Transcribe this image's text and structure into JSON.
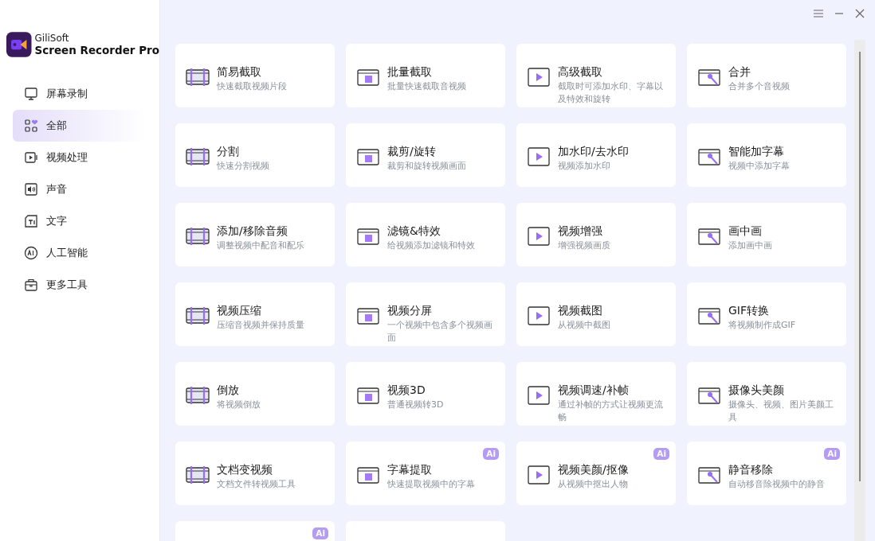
{
  "app": {
    "brand": "GiliSoft",
    "product": "Screen Recorder Pro"
  },
  "sidebar": {
    "items": [
      {
        "label": "屏幕录制",
        "selected": false
      },
      {
        "label": "全部",
        "selected": true
      },
      {
        "label": "视频处理",
        "selected": false
      },
      {
        "label": "声音",
        "selected": false
      },
      {
        "label": "文字",
        "selected": false
      },
      {
        "label": "人工智能",
        "selected": false
      },
      {
        "label": "更多工具",
        "selected": false
      }
    ]
  },
  "cards": [
    {
      "title": "简易截取",
      "description": "快速截取视频片段"
    },
    {
      "title": "批量截取",
      "description": "批量快速截取音视频"
    },
    {
      "title": "高级截取",
      "description": "截取时可添加水印、字幕以及特效和旋转"
    },
    {
      "title": "合并",
      "description": "合并多个音视频"
    },
    {
      "title": "分割",
      "description": "快速分割视频"
    },
    {
      "title": "裁剪/旋转",
      "description": "裁剪和旋转视频画面"
    },
    {
      "title": "加水印/去水印",
      "description": "视频添加水印"
    },
    {
      "title": "智能加字幕",
      "description": "视频中添加字幕"
    },
    {
      "title": "添加/移除音频",
      "description": "调整视频中配音和配乐"
    },
    {
      "title": "滤镜&特效",
      "description": "给视频添加滤镜和特效"
    },
    {
      "title": "视频增强",
      "description": "增强视频画质"
    },
    {
      "title": "画中画",
      "description": "添加画中画"
    },
    {
      "title": "视频压缩",
      "description": "压缩音视频并保持质量"
    },
    {
      "title": "视频分屏",
      "description": "一个视频中包含多个视频画面"
    },
    {
      "title": "视频截图",
      "description": "从视频中截图"
    },
    {
      "title": "GIF转换",
      "description": "将视频制作成GIF"
    },
    {
      "title": "倒放",
      "description": "将视频倒放"
    },
    {
      "title": "视频3D",
      "description": "普通视频转3D"
    },
    {
      "title": "视频调速/补帧",
      "description": "通过补帧的方式让视频更流畅"
    },
    {
      "title": "摄像头美颜",
      "description": "摄像头、视频、图片美颜工具"
    },
    {
      "title": "文档变视频",
      "description": "文档文件转视频工具"
    },
    {
      "title": "字幕提取",
      "description": "快速提取视频中的字幕",
      "badge": "Ai"
    },
    {
      "title": "视频美颜/抠像",
      "description": "从视频中抠出人物",
      "badge": "Ai"
    },
    {
      "title": "静音移除",
      "description": "自动移音除视频中的静音",
      "badge": "Ai"
    },
    {
      "kind": "partial",
      "badge": "Ai"
    },
    {
      "kind": "partial"
    }
  ]
}
